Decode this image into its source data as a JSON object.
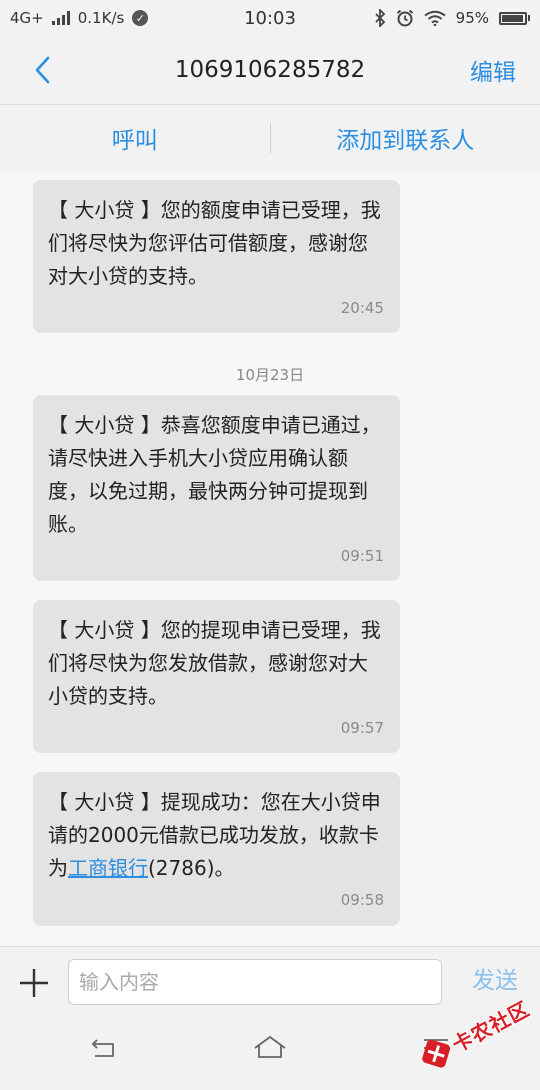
{
  "status_bar": {
    "network": "4G+",
    "speed": "0.1K/s",
    "time": "10:03",
    "battery": "95%",
    "battery_level": 0.95
  },
  "header": {
    "title": "1069106285782",
    "edit_label": "编辑"
  },
  "actions": {
    "call_label": "呼叫",
    "add_contact_label": "添加到联系人"
  },
  "messages": [
    {
      "text": "【 大小贷 】您的额度申请已受理，我们将尽快为您评估可借额度，感谢您对大小贷的支持。",
      "time": "20:45"
    },
    {
      "text": "【 大小贷 】恭喜您额度申请已通过，请尽快进入手机大小贷应用确认额度，以免过期，最快两分钟可提现到账。",
      "time": "09:51"
    },
    {
      "text": "【 大小贷 】您的提现申请已受理，我们将尽快为您发放借款，感谢您对大小贷的支持。",
      "time": "09:57"
    },
    {
      "text_before": "【 大小贷 】提现成功：您在大小贷申请的2000元借款已成功发放，收款卡为",
      "link": "工商银行",
      "text_after": "(2786)。",
      "time": "09:58"
    }
  ],
  "date_separator": "10月23日",
  "composer": {
    "placeholder": "输入内容",
    "send_label": "发送"
  },
  "watermark": {
    "text": "卡农社区"
  },
  "colors": {
    "accent": "#2b8ee0",
    "bubble": "#e3e3e3",
    "watermark_red": "#d91f26"
  }
}
